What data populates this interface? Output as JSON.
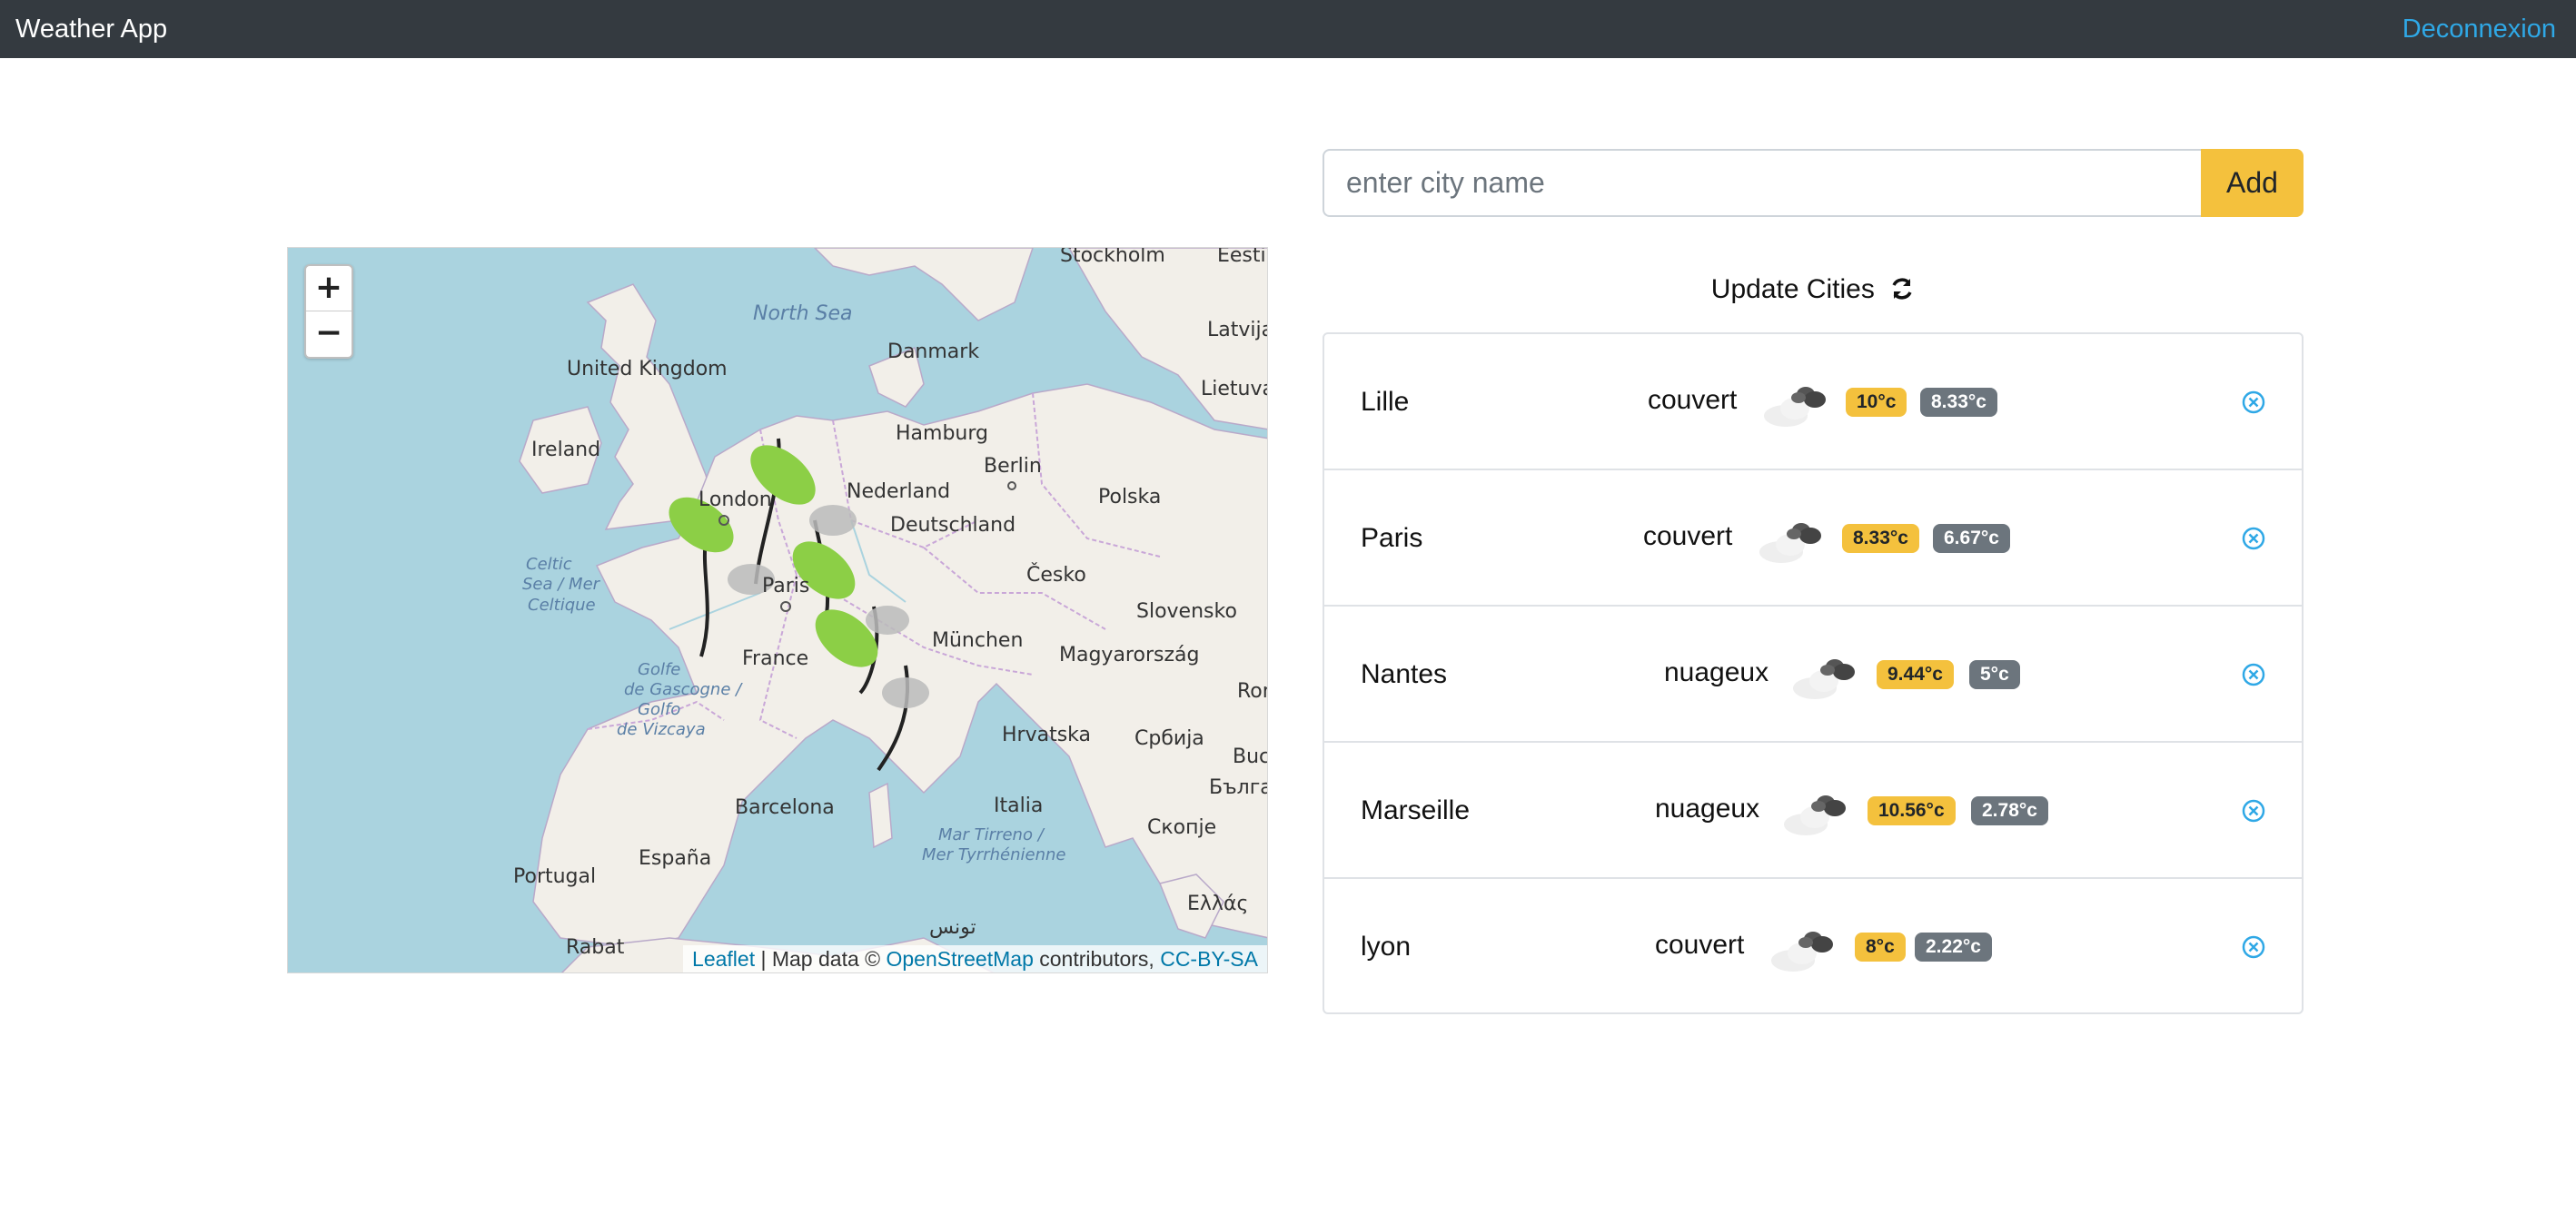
{
  "navbar": {
    "brand": "Weather App",
    "logout": "Deconnexion"
  },
  "search": {
    "placeholder": "enter city name",
    "add_label": "Add"
  },
  "update": {
    "label": "Update Cities"
  },
  "cities": [
    {
      "name": "Lille",
      "description": "couvert",
      "max": "10°c",
      "min": "8.33°c"
    },
    {
      "name": "Paris",
      "description": "couvert",
      "max": "8.33°c",
      "min": "6.67°c"
    },
    {
      "name": "Nantes",
      "description": "nuageux",
      "max": "9.44°c",
      "min": "5°c"
    },
    {
      "name": "Marseille",
      "description": "nuageux",
      "max": "10.56°c",
      "min": "2.78°c"
    },
    {
      "name": "lyon",
      "description": "couvert",
      "max": "8°c",
      "min": "2.22°c"
    }
  ],
  "map": {
    "zoom_in": "+",
    "zoom_out": "−",
    "attribution": {
      "leaflet": "Leaflet",
      "sep": " | Map data © ",
      "osm": "OpenStreetMap",
      "contrib": " contributors, ",
      "license": "CC-BY-SA"
    },
    "labels": {
      "stockholm": "Stockholm",
      "eesti": "Eesti",
      "north_sea": "North Sea",
      "danmark": "Danmark",
      "latvija": "Latvija",
      "uk": "United Kingdom",
      "lietuva": "Lietuva",
      "ireland": "Ireland",
      "hamburg": "Hamburg",
      "berlin": "Berlin",
      "nederland": "Nederland",
      "london": "London",
      "polska": "Polska",
      "deutschland": "Deutschland",
      "celtic1": "Celtic",
      "celtic2": "Sea / Mer",
      "celtic3": "Celtique",
      "paris": "Paris",
      "cesko": "Česko",
      "slovensko": "Slovensko",
      "munchen": "München",
      "france": "France",
      "magyar": "Magyarország",
      "golfe1": "Golfe",
      "golfe2": "de Gascogne /",
      "golfe3": "Golfo",
      "golfe4": "de Vizcaya",
      "romania": "Româ",
      "hrvatska": "Hrvatska",
      "srbija": "Србија",
      "buc": "Buc",
      "balg": "Бълга",
      "barcelona": "Barcelona",
      "italia": "Italia",
      "espana": "España",
      "skopje": "Скопје",
      "tirreno1": "Mar Tirreno /",
      "tirreno2": "Mer Tyrrhénienne",
      "portugal": "Portugal",
      "tunis": "تونس",
      "ellas": "Ελλάς",
      "rabat": "Rabat"
    }
  },
  "colors": {
    "navbar": "#343a40",
    "accent": "#f4c13d",
    "link": "#2fa8e6",
    "min_badge": "#6c757d"
  }
}
